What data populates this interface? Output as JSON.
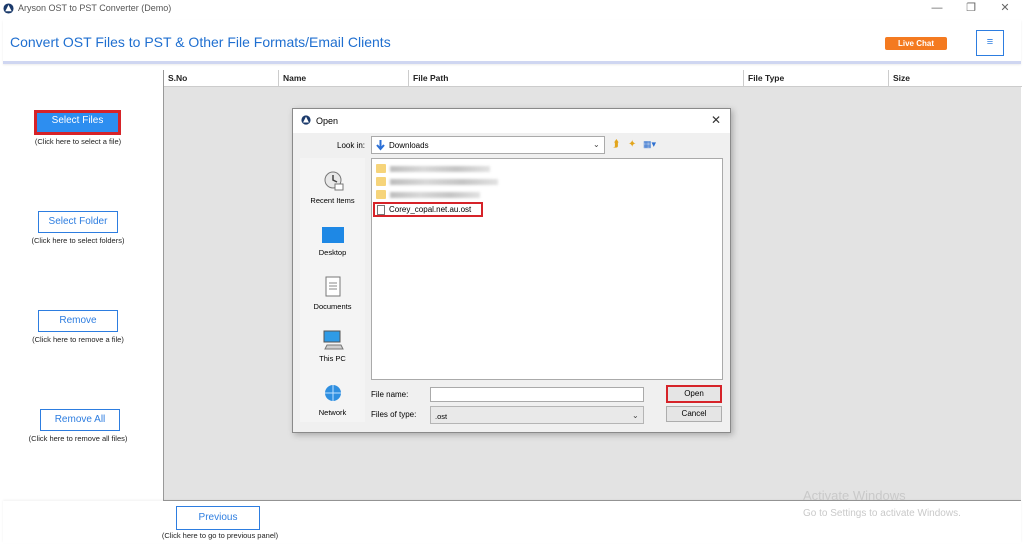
{
  "window": {
    "title": "Aryson OST to PST Converter (Demo)",
    "minimize": "—",
    "restore": "❐",
    "close": "✕"
  },
  "header": {
    "title": "Convert OST Files to PST & Other File Formats/Email Clients",
    "live_chat": "Live Chat",
    "menu_icon": "≡",
    "accent_color": "#1f6fd0",
    "live_chat_color": "#f47a20"
  },
  "sidebar": {
    "select_files": {
      "label": "Select Files",
      "hint": "(Click here to select a file)"
    },
    "select_folder": {
      "label": "Select Folder",
      "hint": "(Click here to select folders)"
    },
    "remove": {
      "label": "Remove",
      "hint": "(Click here to remove a file)"
    },
    "remove_all": {
      "label": "Remove All",
      "hint": "(Click here to remove all files)"
    }
  },
  "table": {
    "columns": [
      "S.No",
      "Name",
      "File Path",
      "File Type",
      "Size"
    ],
    "rows": []
  },
  "footer": {
    "previous": {
      "label": "Previous",
      "hint": "(Click here to go to previous panel)"
    },
    "activation": {
      "line1": "Activate Windows",
      "line2": "Go to Settings to activate Windows."
    }
  },
  "dialog": {
    "title": "Open",
    "close": "✕",
    "look_in_label": "Look in:",
    "look_in_value": "Downloads",
    "places": [
      "Recent Items",
      "Desktop",
      "Documents",
      "This PC",
      "Network"
    ],
    "files": [
      {
        "name": "Corey_copal.net.au.ost",
        "highlighted": true
      }
    ],
    "file_name_label": "File name:",
    "file_name_value": "",
    "file_type_label": "Files of type:",
    "file_type_value": ".ost",
    "open_button": "Open",
    "cancel_button": "Cancel"
  },
  "colors": {
    "highlight_border": "#d62329",
    "button_blue": "#2d7de0",
    "primary_fill": "#2d8ef0"
  }
}
